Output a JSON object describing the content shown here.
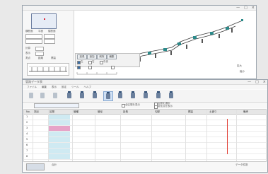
{
  "top_window": {
    "controls": [
      "—",
      "□",
      "×"
    ],
    "left_panel": {
      "labels": [
        "横断面",
        "平面",
        "縦断面"
      ],
      "options": [
        "計算",
        "表示"
      ],
      "fields": [
        "測点",
        "距離",
        "標高"
      ]
    },
    "center_panel": {
      "buttons": [
        "延長",
        "追加",
        "削除",
        "編集"
      ],
      "radio_labels": [
        "左",
        "右",
        "中央"
      ],
      "corner_labels": [
        "拡大",
        "縮小"
      ]
    }
  },
  "bottom_window": {
    "title": "管路データ表",
    "controls": [
      "—",
      "□",
      "×"
    ],
    "menu": [
      "ファイル",
      "編集",
      "表示",
      "設定",
      "ツール",
      "ヘルプ"
    ],
    "filter": {
      "field_value": "",
      "checkbox_labels": [
        "全区間を表示",
        "区間を選択",
        "変化点を表示"
      ]
    },
    "grid": {
      "columns": [
        "No.",
        "測点",
        "区間",
        "管種",
        "管径",
        "延長",
        "勾配",
        "標高",
        "土被り",
        "備考"
      ],
      "rows": [
        {
          "no": "1",
          "station": "",
          "v1": "",
          "v2": "",
          "v3": "",
          "v4": "",
          "v5": ""
        },
        {
          "no": "2",
          "station": "",
          "v1": "",
          "v2": "",
          "v3": "",
          "v4": "",
          "v5": ""
        },
        {
          "no": "3",
          "station": "",
          "v1": "",
          "v2": "",
          "v3": "",
          "v4": "",
          "v5": ""
        },
        {
          "no": "4",
          "station": "",
          "v1": "",
          "v2": "",
          "v3": "",
          "v4": "",
          "v5": ""
        },
        {
          "no": "5",
          "station": "",
          "v1": "",
          "v2": "",
          "v3": "",
          "v4": "",
          "v5": ""
        },
        {
          "no": "6",
          "station": "",
          "v1": "",
          "v2": "",
          "v3": "",
          "v4": "",
          "v5": ""
        },
        {
          "no": "7",
          "station": "",
          "v1": "",
          "v2": "",
          "v3": "",
          "v4": "",
          "v5": ""
        },
        {
          "no": "8",
          "station": "",
          "v1": "",
          "v2": "",
          "v3": "",
          "v4": "",
          "v5": ""
        }
      ],
      "highlight_color": "#e6a4c8",
      "accent_color": "#cfeaf2",
      "marker_color": "#e0342a"
    },
    "summary": {
      "label_left": "合計",
      "value_mid": "",
      "label_right": "データ件数"
    }
  },
  "status": {
    "text": ""
  }
}
